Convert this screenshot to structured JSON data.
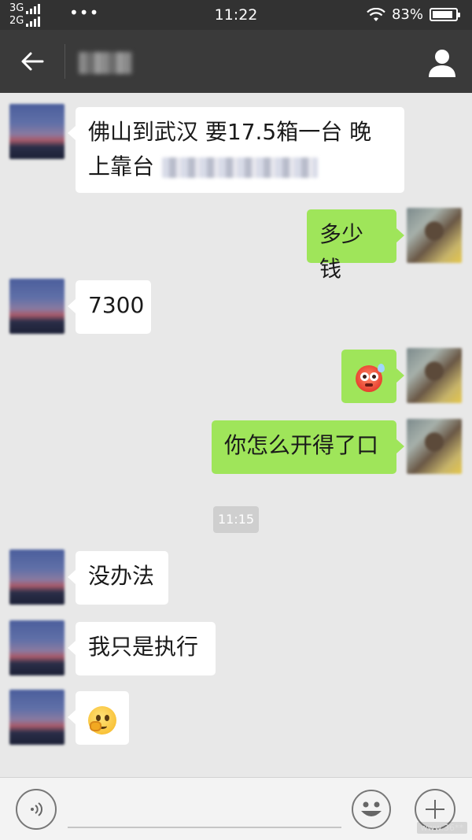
{
  "status_bar": {
    "network_line1": "3G",
    "network_line2": "2G",
    "dots": "•••",
    "time": "11:22",
    "battery": "83%"
  },
  "nav": {
    "title": "曲 叉"
  },
  "messages": [
    {
      "from": "other",
      "text": "佛山到武汉 要17.5箱一台 晚上靠台"
    },
    {
      "from": "self",
      "text": "多少钱"
    },
    {
      "from": "other",
      "text": "7300"
    },
    {
      "from": "self",
      "emoji": "flushed-face-emoji"
    },
    {
      "from": "self",
      "text": "你怎么开得了口"
    },
    {
      "from": "time",
      "text": "11:15"
    },
    {
      "from": "other",
      "text": "没办法"
    },
    {
      "from": "other",
      "text": "我只是执行"
    },
    {
      "from": "other",
      "emoji": "thinking-face-emoji"
    }
  ],
  "input": {
    "value": ""
  },
  "watermark": "www.36**"
}
